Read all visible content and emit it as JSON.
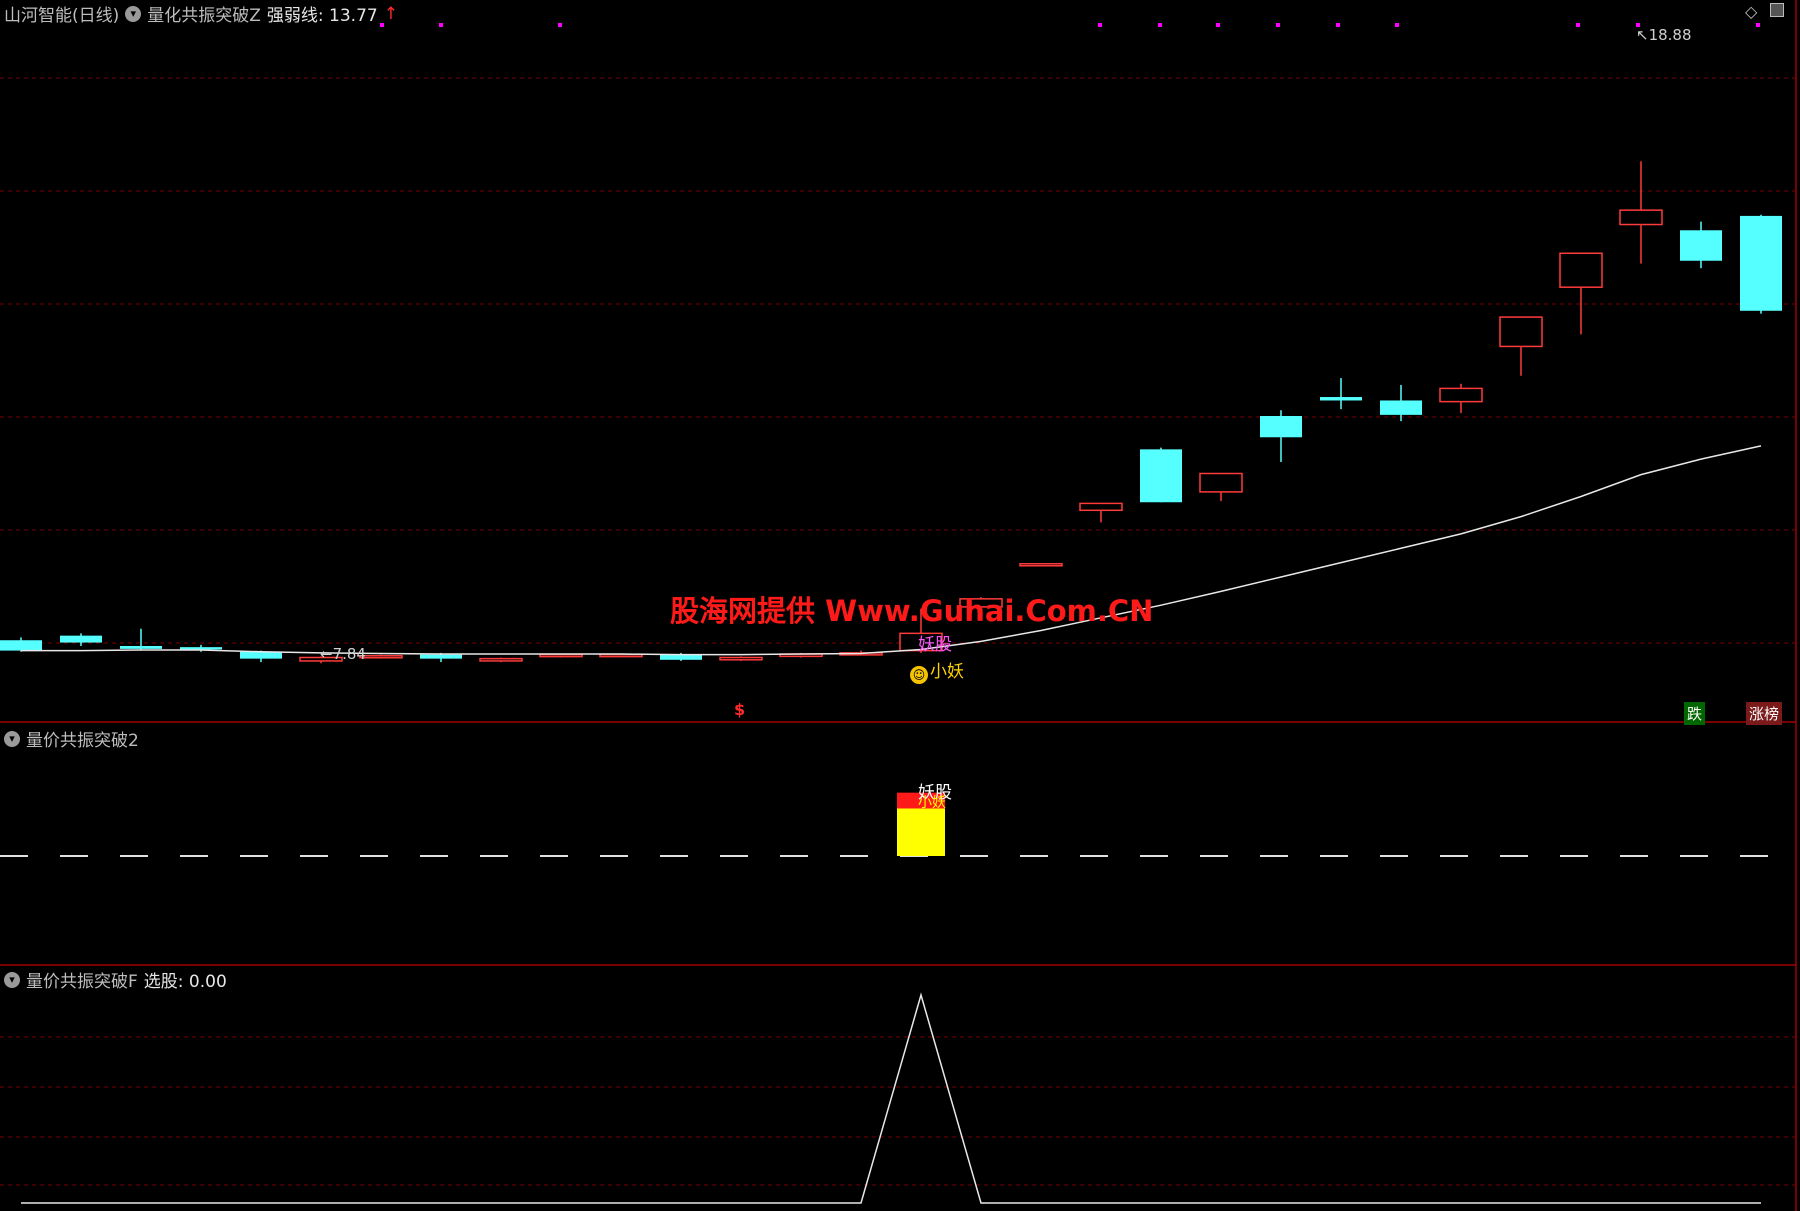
{
  "header": {
    "stock_name": "山河智能(日线)",
    "indicator": "量化共振突破Z",
    "line_label": "强弱线: 13.77",
    "arrow": "↑"
  },
  "panel2": {
    "title": "量价共振突破2"
  },
  "panel3": {
    "title": "量价共振突破F",
    "select_label": "选股: 0.00"
  },
  "labels": {
    "high": "18.88",
    "low": "7.84",
    "watermark": "股海网提供 Www.Guhai.Com.CN",
    "yaogu": "妖股",
    "xiaoyao": "小妖",
    "dollar": "$",
    "die": "跌",
    "zhangbang": "涨榜",
    "bar_yaogu": "妖股",
    "bar_xiaoyao": "小妖",
    "high_arrow": "↖",
    "low_arrow": "←"
  },
  "colors": {
    "up": "#ff3b3b",
    "down": "#55ffff",
    "ma": "#e8e8e8",
    "grid": "#7a0000",
    "dots": "#ff00ff",
    "watermark": "#ff1a1a",
    "yellow": "#ffff00"
  },
  "chart_data": {
    "type": "candlestick",
    "candles": [
      {
        "o": 8.2,
        "h": 8.25,
        "l": 8.0,
        "c": 8.02
      },
      {
        "o": 8.28,
        "h": 8.32,
        "l": 8.1,
        "c": 8.16
      },
      {
        "o": 8.1,
        "h": 8.4,
        "l": 8.02,
        "c": 8.05
      },
      {
        "o": 8.08,
        "h": 8.12,
        "l": 8.0,
        "c": 8.04
      },
      {
        "o": 8.0,
        "h": 8.02,
        "l": 7.82,
        "c": 7.88
      },
      {
        "o": 7.84,
        "h": 7.92,
        "l": 7.8,
        "c": 7.9
      },
      {
        "o": 7.9,
        "h": 7.95,
        "l": 7.88,
        "c": 7.93
      },
      {
        "o": 7.95,
        "h": 7.98,
        "l": 7.82,
        "c": 7.88
      },
      {
        "o": 7.84,
        "h": 7.9,
        "l": 7.82,
        "c": 7.88
      },
      {
        "o": 7.92,
        "h": 7.96,
        "l": 7.9,
        "c": 7.95
      },
      {
        "o": 7.93,
        "h": 7.97,
        "l": 7.91,
        "c": 7.95
      },
      {
        "o": 7.96,
        "h": 7.98,
        "l": 7.84,
        "c": 7.86
      },
      {
        "o": 7.86,
        "h": 7.92,
        "l": 7.84,
        "c": 7.9
      },
      {
        "o": 7.92,
        "h": 7.98,
        "l": 7.9,
        "c": 7.96
      },
      {
        "o": 7.96,
        "h": 8.02,
        "l": 7.94,
        "c": 7.98
      },
      {
        "o": 8.02,
        "h": 8.75,
        "l": 7.98,
        "c": 8.32
      },
      {
        "o": 8.78,
        "h": 8.95,
        "l": 8.6,
        "c": 8.92
      },
      {
        "o": 9.52,
        "h": 9.53,
        "l": 9.51,
        "c": 9.53
      },
      {
        "o": 10.46,
        "h": 10.52,
        "l": 10.25,
        "c": 10.58
      },
      {
        "o": 11.52,
        "h": 11.55,
        "l": 10.6,
        "c": 10.6
      },
      {
        "o": 10.78,
        "h": 11.1,
        "l": 10.62,
        "c": 11.1
      },
      {
        "o": 12.1,
        "h": 12.2,
        "l": 11.3,
        "c": 11.73
      },
      {
        "o": 12.43,
        "h": 12.76,
        "l": 12.22,
        "c": 12.37
      },
      {
        "o": 12.37,
        "h": 12.64,
        "l": 12.01,
        "c": 12.12
      },
      {
        "o": 12.35,
        "h": 12.66,
        "l": 12.15,
        "c": 12.58
      },
      {
        "o": 13.31,
        "h": 13.32,
        "l": 12.8,
        "c": 13.82
      },
      {
        "o": 14.34,
        "h": 14.36,
        "l": 13.52,
        "c": 14.93
      },
      {
        "o": 15.43,
        "h": 16.53,
        "l": 14.75,
        "c": 15.68
      },
      {
        "o": 15.33,
        "h": 15.48,
        "l": 14.67,
        "c": 14.8
      },
      {
        "o": 15.58,
        "h": 15.6,
        "l": 13.88,
        "c": 13.93
      }
    ],
    "ma": [
      8.02,
      8.02,
      8.03,
      8.03,
      8.0,
      7.98,
      7.97,
      7.96,
      7.96,
      7.96,
      7.96,
      7.95,
      7.95,
      7.96,
      7.97,
      8.04,
      8.18,
      8.37,
      8.59,
      8.81,
      9.05,
      9.3,
      9.55,
      9.8,
      10.05,
      10.35,
      10.7,
      11.08,
      11.35,
      11.58
    ],
    "ylim": [
      7.3,
      18.9
    ],
    "signal_bar": {
      "index": 15,
      "yellow_top": 0.72,
      "red_top": 0.96
    },
    "signal_line": [
      0,
      0,
      0,
      0,
      0,
      0,
      0,
      0,
      0,
      0,
      0,
      0,
      0,
      0,
      0,
      1,
      0,
      0,
      0,
      0,
      0,
      0,
      0,
      0,
      0,
      0,
      0,
      0,
      0,
      0
    ]
  }
}
